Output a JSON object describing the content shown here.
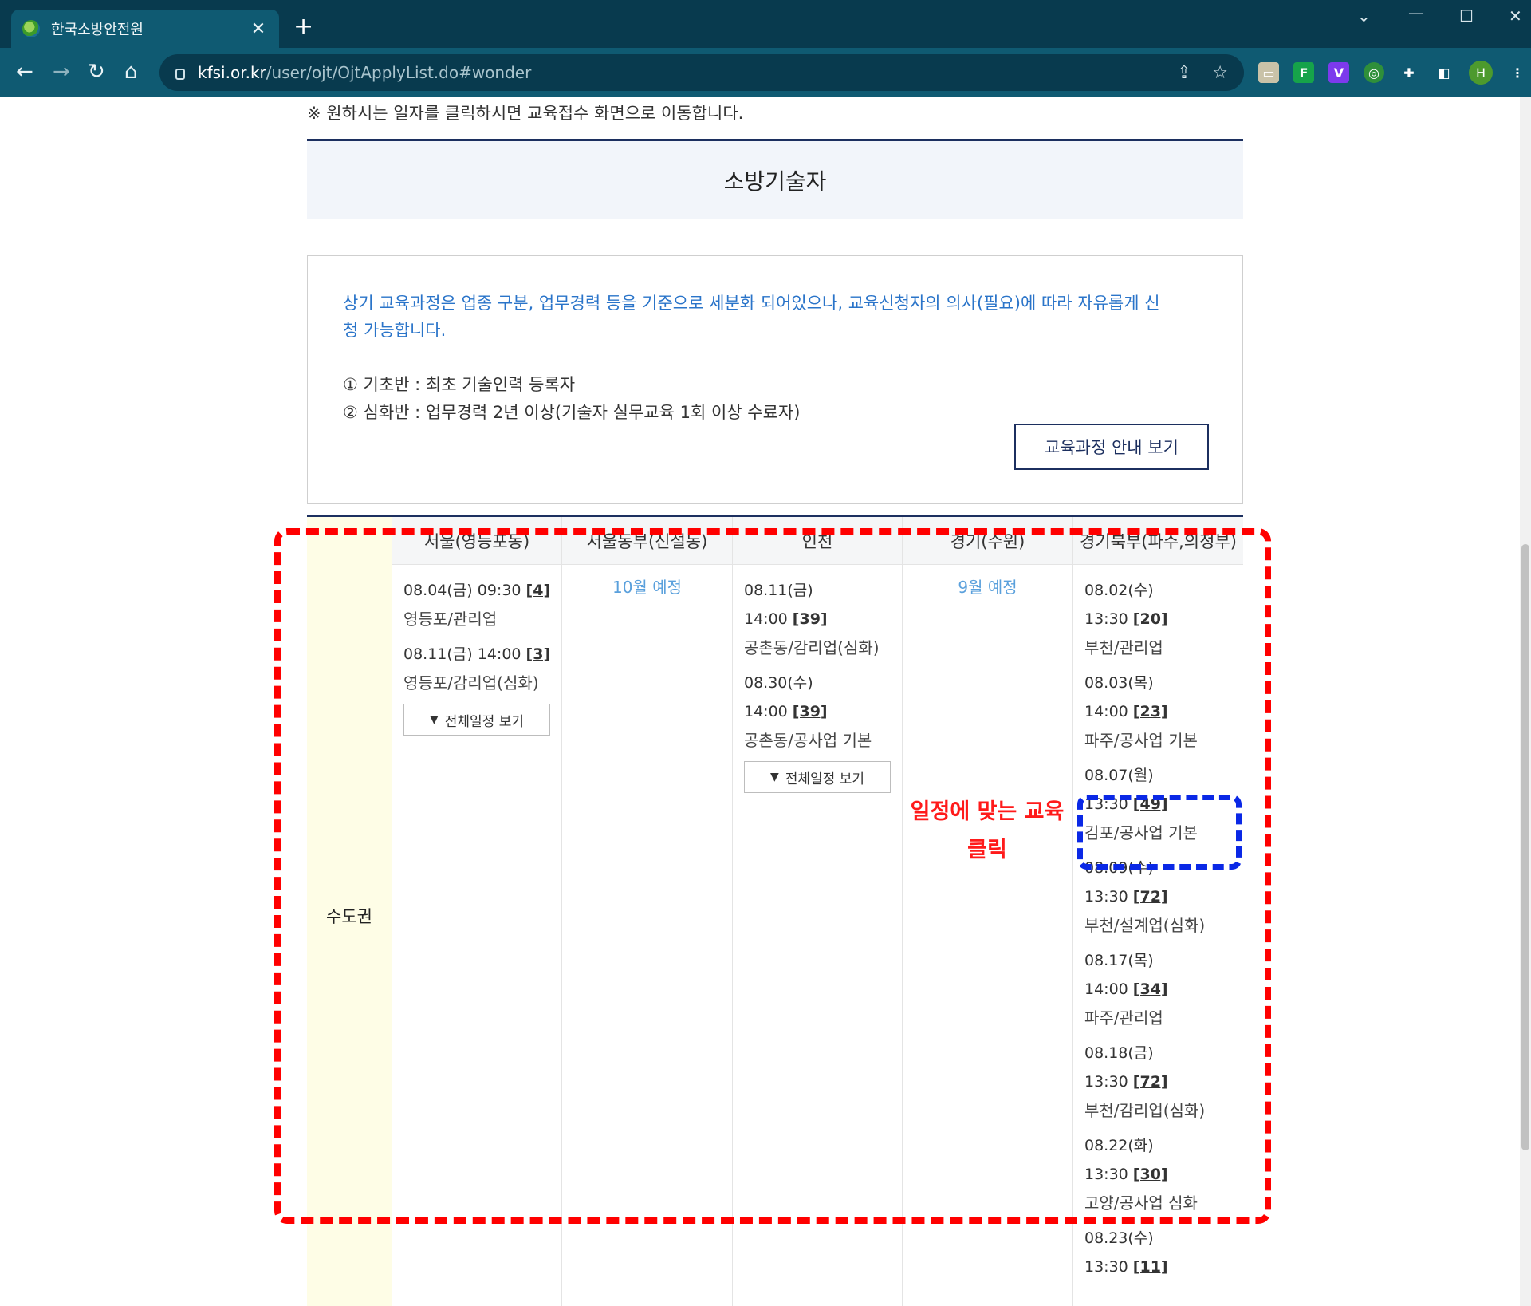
{
  "browser": {
    "tab_title": "한국소방안전원",
    "tab_close": "✕",
    "new_tab": "+",
    "url_host": "kfsi.or.kr",
    "url_path": "/user/ojt/OjtApplyList.do#wonder",
    "avatar_letter": "H"
  },
  "page": {
    "notice": "※ 원하시는 일자를 클릭하시면 교육접수 화면으로 이동합니다.",
    "section_title": "소방기술자",
    "info": {
      "blue_text": "상기 교육과정은 업종 구분, 업무경력 등을 기준으로 세분화 되어있으나, 교육신청자의 의사(필요)에 따라 자유롭게 신청 가능합니다.",
      "item1": "① 기초반 : 최초 기술인력 등록자",
      "item2": "② 심화반 : 업무경력 2년 이상(기술자 실무교육 1회 이상 수료자)",
      "guide_button": "교육과정 안내 보기"
    },
    "region": "수도권",
    "columns": [
      {
        "header": "서울(영등포동)",
        "entries": [
          {
            "line1": "08.04(금) 09:30 ",
            "count": "[4]",
            "loc": "영등포/관리업"
          },
          {
            "line1": "08.11(금) 14:00 ",
            "count": "[3]",
            "loc": "영등포/감리업(심화)"
          }
        ],
        "button": "전체일정 보기"
      },
      {
        "header": "서울동부(신설동)",
        "planned": "10월 예정"
      },
      {
        "header": "인천",
        "entries": [
          {
            "date": "08.11(금)",
            "time": "14:00 ",
            "count": "[39]",
            "loc": "공촌동/감리업(심화)"
          },
          {
            "date": "08.30(수)",
            "time": "14:00 ",
            "count": "[39]",
            "loc": "공촌동/공사업 기본"
          }
        ],
        "button": "전체일정 보기"
      },
      {
        "header": "경기(수원)",
        "planned": "9월 예정"
      },
      {
        "header": "경기북부(파주,의정부)",
        "entries": [
          {
            "date": "08.02(수)",
            "time": "13:30 ",
            "count": "[20]",
            "loc": "부천/관리업"
          },
          {
            "date": "08.03(목)",
            "time": "14:00 ",
            "count": "[23]",
            "loc": "파주/공사업 기본"
          },
          {
            "date": "08.07(월)",
            "time": "13:30 ",
            "count": "[49]",
            "loc": "김포/공사업 기본"
          },
          {
            "date": "08.09(수)",
            "time": "13:30 ",
            "count": "[72]",
            "loc": "부천/설계업(심화)"
          },
          {
            "date": "08.17(목)",
            "time": "14:00 ",
            "count": "[34]",
            "loc": "파주/관리업"
          },
          {
            "date": "08.18(금)",
            "time": "13:30 ",
            "count": "[72]",
            "loc": "부천/감리업(심화)"
          },
          {
            "date": "08.22(화)",
            "time": "13:30 ",
            "count": "[30]",
            "loc": "고양/공사업 심화"
          },
          {
            "date": "08.23(수)",
            "time": "13:30 ",
            "count": "[11]",
            "loc": ""
          }
        ]
      }
    ]
  },
  "annotation": {
    "label_line1": "일정에 맞는 교육",
    "label_line2": "클릭",
    "red_color": "#ff0000",
    "blue_color": "#0a28e6"
  },
  "colors": {
    "tab_bar": "#083a4e",
    "toolbar": "#0f5a72",
    "info_blue": "#2a74c9",
    "region_bg": "#fefde6",
    "navy": "#1c2f5f"
  }
}
